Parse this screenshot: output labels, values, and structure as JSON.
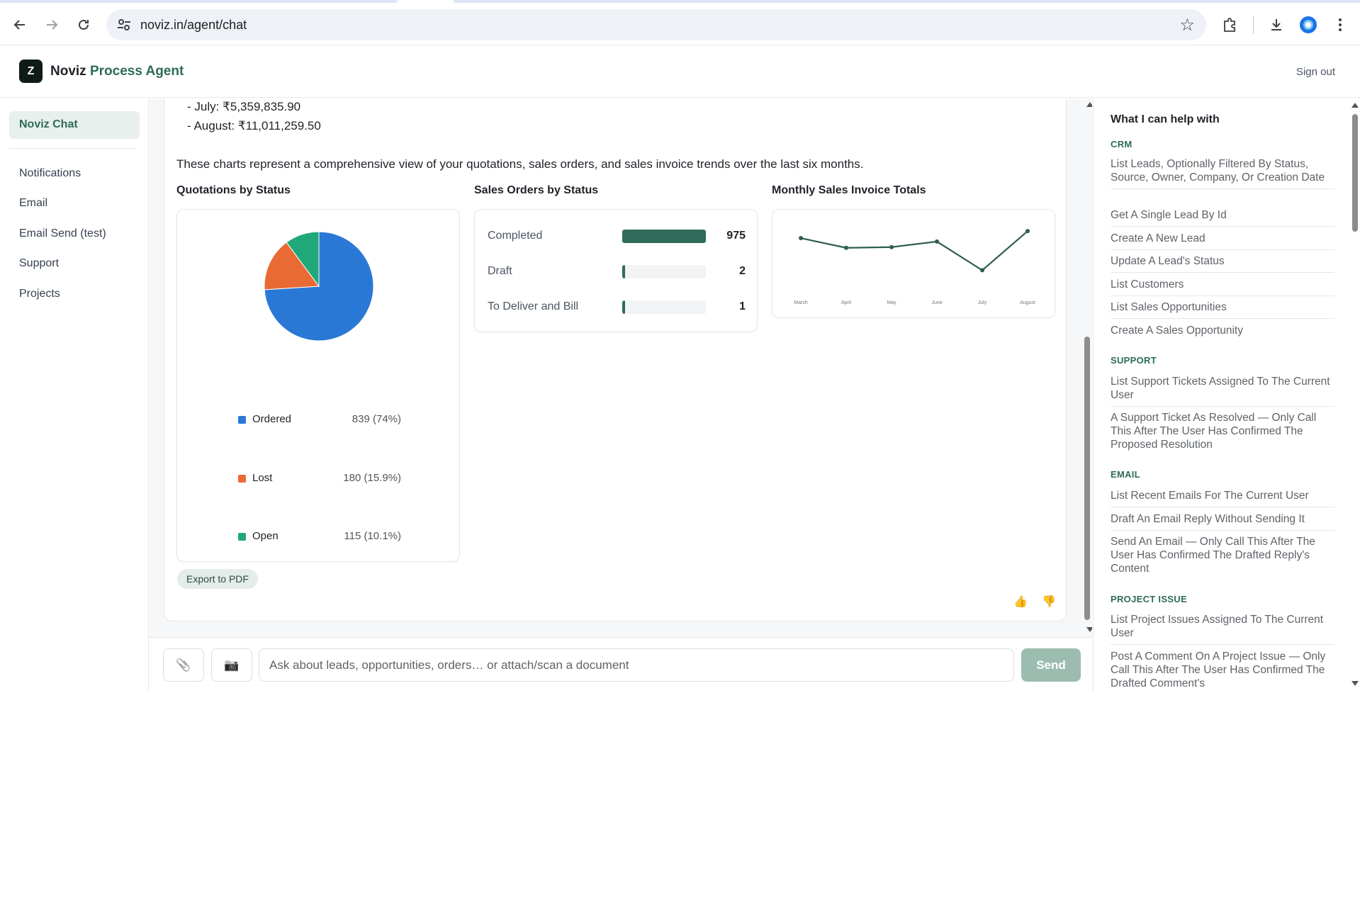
{
  "browser": {
    "url": "noviz.in/agent/chat"
  },
  "header": {
    "logo_letter": "Z",
    "brand_name": "Noviz",
    "brand_accent": "Process Agent",
    "sign_out": "Sign out"
  },
  "sidebar": {
    "active": "Noviz Chat",
    "items": [
      "Notifications",
      "Email",
      "Email Send (test)",
      "Support",
      "Projects"
    ]
  },
  "message": {
    "lines": [
      "- July: ₹5,359,835.90",
      "- August: ₹11,011,259.50"
    ],
    "summary": "These charts represent a comprehensive view of your quotations, sales orders, and sales invoice trends over the last six months.",
    "export_label": "Export to PDF",
    "thumbs_up": "👍",
    "thumbs_down": "👎"
  },
  "chart_data": [
    {
      "type": "pie",
      "title": "Quotations by Status",
      "categories": [
        "Ordered",
        "Lost",
        "Open"
      ],
      "values": [
        839,
        180,
        115
      ],
      "value_labels": [
        "839 (74%)",
        "180 (15.9%)",
        "115 (10.1%)"
      ],
      "colors": [
        "#2a78d6",
        "#ea6a35",
        "#21a87a"
      ]
    },
    {
      "type": "bar",
      "title": "Sales Orders by Status",
      "categories": [
        "Completed",
        "Draft",
        "To Deliver and Bill"
      ],
      "values": [
        975,
        2,
        1
      ],
      "colors": [
        "#2f6b5a"
      ]
    },
    {
      "type": "line",
      "title": "Monthly Sales Invoice Totals",
      "x": [
        "March",
        "April",
        "May",
        "June",
        "July",
        "August"
      ],
      "values": [
        10000000,
        8600000,
        8700000,
        9500000,
        5359835.9,
        11011259.5
      ],
      "colors": [
        "#2f5e4f"
      ]
    }
  ],
  "input": {
    "attach_icon": "📎",
    "camera_icon": "📷",
    "placeholder": "Ask about leads, opportunities, orders… or attach/scan a document",
    "send_label": "Send"
  },
  "help": {
    "title": "What I can help with",
    "sections": [
      {
        "name": "CRM",
        "items": [
          "List Leads, Optionally Filtered By Status, Source, Owner, Company, Or Creation Date",
          "Get A Single Lead By Id",
          "Create A New Lead",
          "Update A Lead's Status",
          "List Customers",
          "List Sales Opportunities",
          "Create A Sales Opportunity"
        ]
      },
      {
        "name": "SUPPORT",
        "items": [
          "List Support Tickets Assigned To The Current User",
          "A Support Ticket As Resolved — Only Call This After The User Has Confirmed The Proposed Resolution"
        ]
      },
      {
        "name": "EMAIL",
        "items": [
          "List Recent Emails For The Current User",
          "Draft An Email Reply Without Sending It",
          "Send An Email — Only Call This After The User Has Confirmed The Drafted Reply's Content"
        ]
      },
      {
        "name": "PROJECT ISSUE",
        "items": [
          "List Project Issues Assigned To The Current User",
          "Post A Comment On A Project Issue — Only Call This After The User Has Confirmed The Drafted Comment's"
        ]
      }
    ]
  }
}
